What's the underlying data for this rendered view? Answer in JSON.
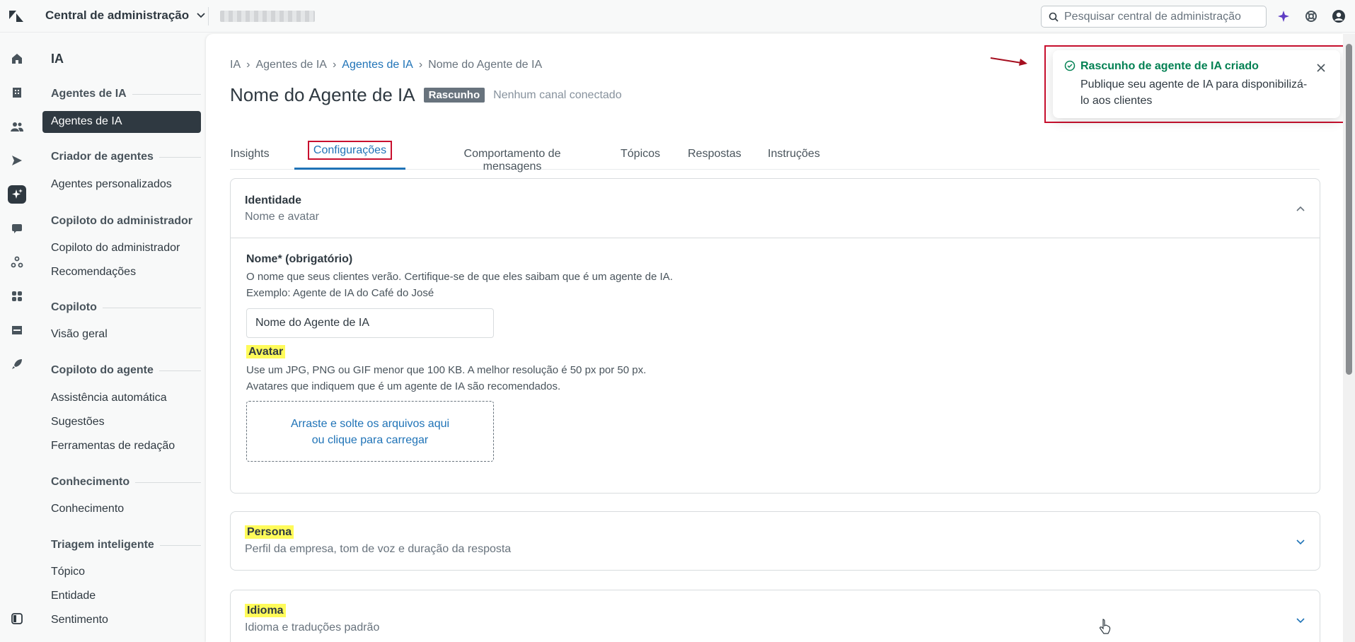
{
  "header": {
    "app_name": "Central de administração",
    "search_placeholder": "Pesquisar central de administração"
  },
  "sidenav": {
    "title": "IA",
    "sections": [
      {
        "label": "Agentes de IA"
      },
      {
        "label": "Criador de agentes"
      },
      {
        "label": "Copiloto do administrador"
      },
      {
        "label": "Copiloto"
      },
      {
        "label": "Copiloto do agente"
      },
      {
        "label": "Conhecimento"
      },
      {
        "label": "Triagem inteligente"
      }
    ],
    "items": [
      {
        "label": "Agentes de IA"
      },
      {
        "label": "Agentes personalizados"
      },
      {
        "label": "Copiloto do administrador"
      },
      {
        "label": "Recomendações"
      },
      {
        "label": "Visão geral"
      },
      {
        "label": "Assistência automática"
      },
      {
        "label": "Sugestões"
      },
      {
        "label": "Ferramentas de redação"
      },
      {
        "label": "Conhecimento"
      },
      {
        "label": "Tópico"
      },
      {
        "label": "Entidade"
      },
      {
        "label": "Sentimento"
      }
    ]
  },
  "breadcrumb": [
    "IA",
    "Agentes de IA",
    "Agentes de IA",
    "Nome do Agente de IA"
  ],
  "page": {
    "title": "Nome do Agente de IA",
    "badge": "Rascunho",
    "channel_status": "Nenhum canal conectado"
  },
  "tabs": [
    "Insights",
    "Configurações",
    "Comportamento de mensagens",
    "Tópicos",
    "Respostas",
    "Instruções"
  ],
  "identity": {
    "title": "Identidade",
    "subtitle": "Nome e avatar",
    "name_label": "Nome* (obrigatório)",
    "name_help_1": "O nome que seus clientes verão. Certifique-se de que eles saibam que é um agente de IA.",
    "name_help_2": "Exemplo: Agente de IA do Café do José",
    "name_value": "Nome do Agente de IA",
    "avatar_label": "Avatar",
    "avatar_help_1": "Use um JPG, PNG ou GIF menor que 100 KB. A melhor resolução é 50 px por 50 px.",
    "avatar_help_2": "Avatares que indiquem que é um agente de IA são recomendados.",
    "dropzone_line_1": "Arraste e solte os arquivos aqui",
    "dropzone_line_2": "ou clique para carregar"
  },
  "persona": {
    "title": "Persona",
    "subtitle": "Perfil da empresa, tom de voz e duração da resposta"
  },
  "language": {
    "title": "Idioma",
    "subtitle": "Idioma e traduções padrão"
  },
  "toast": {
    "title": "Rascunho de agente de IA criado",
    "body": "Publique seu agente de IA para disponibilizá-lo aos clientes"
  },
  "colors": {
    "accent": "#1f73b7",
    "success": "#038153",
    "highlight": "#fffb5a",
    "annotation": "#c8102e"
  }
}
